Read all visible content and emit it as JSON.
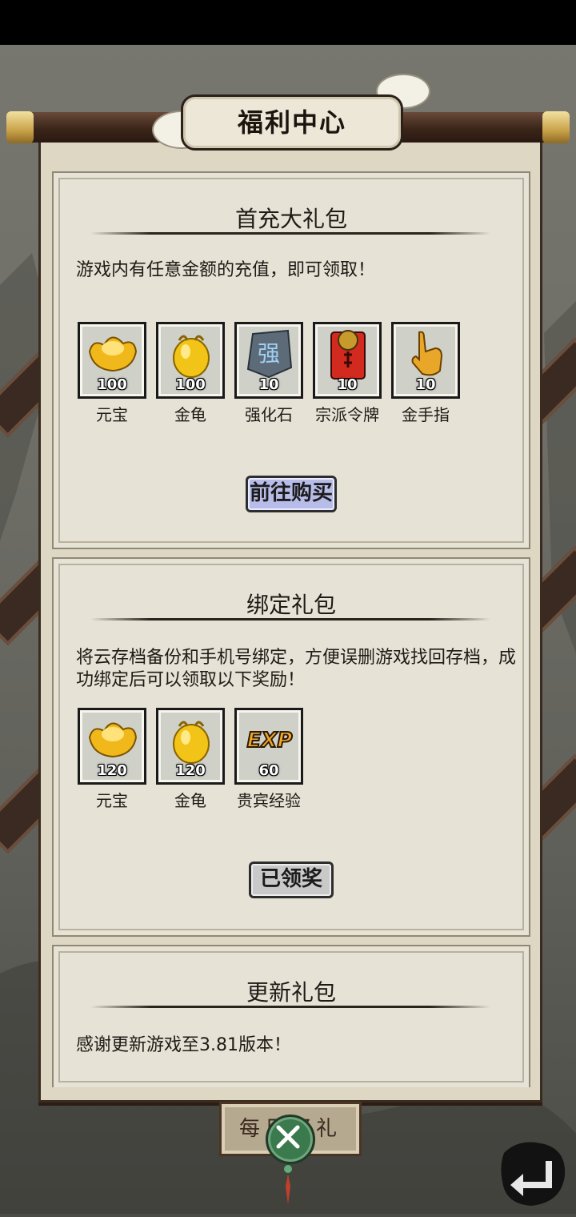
{
  "page": {
    "title": "福利中心"
  },
  "cards": [
    {
      "title": "首充大礼包",
      "description": "游戏内有任意金额的充值，即可领取！",
      "items": [
        {
          "name": "元宝",
          "qty": "100",
          "icon": "gold-ingot-icon"
        },
        {
          "name": "金龟",
          "qty": "100",
          "icon": "gold-turtle-icon"
        },
        {
          "name": "强化石",
          "qty": "10",
          "icon": "enhance-stone-icon"
        },
        {
          "name": "宗派令牌",
          "qty": "10",
          "icon": "sect-token-icon"
        },
        {
          "name": "金手指",
          "qty": "10",
          "icon": "golden-finger-icon"
        }
      ],
      "button": "前往购买"
    },
    {
      "title": "绑定礼包",
      "description": "将云存档备份和手机号绑定，方便误删游戏找回存档，成功绑定后可以领取以下奖励！",
      "items": [
        {
          "name": "元宝",
          "qty": "120",
          "icon": "gold-ingot-icon"
        },
        {
          "name": "金龟",
          "qty": "120",
          "icon": "gold-turtle-icon"
        },
        {
          "name": "贵宾经验",
          "qty": "60",
          "icon": "exp-icon"
        }
      ],
      "button": "已领奖"
    },
    {
      "title": "更新礼包",
      "description": "感谢更新游戏至3.81版本！"
    }
  ],
  "stone_glyph": "强",
  "exp_glyph": "EXP",
  "daily_button": "每日好礼",
  "colors": {
    "buy_button": "#b8bce8",
    "claimed_button": "#c9c9c9",
    "paper": "#ddd7c4",
    "close_button": "#3b7a4c"
  }
}
